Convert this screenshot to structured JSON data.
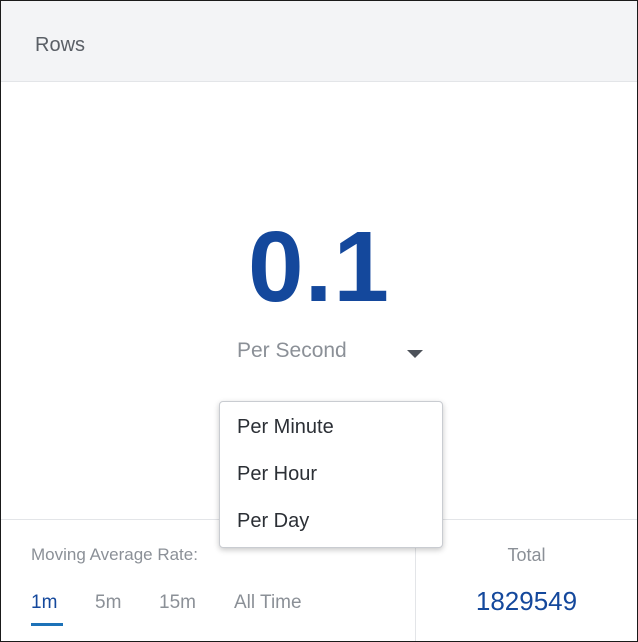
{
  "panel": {
    "title": "Rows",
    "value": "0.1",
    "unit_selected": "Per Second",
    "unit_options": [
      "Per Minute",
      "Per Hour",
      "Per Day"
    ]
  },
  "footer": {
    "rate_label": "Moving Average Rate:",
    "rate_tabs": [
      "1m",
      "5m",
      "15m",
      "All Time"
    ],
    "active_tab": "1m",
    "total_label": "Total",
    "total_value": "1829549"
  },
  "colors": {
    "value": "#14489c",
    "active_tab_underline": "#1d72b8",
    "header_bg": "#f3f4f6"
  },
  "icons": {
    "unit_dropdown": "caret-down-icon"
  }
}
